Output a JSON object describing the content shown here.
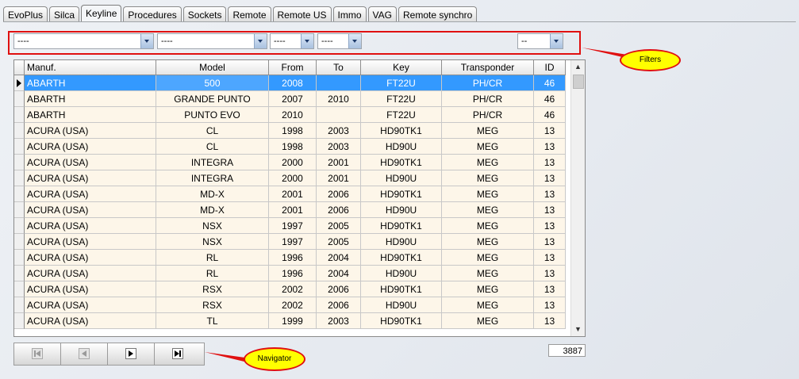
{
  "tabs": [
    "EvoPlus",
    "Silca",
    "Keyline",
    "Procedures",
    "Sockets",
    "Remote",
    "Remote US",
    "Immo",
    "VAG",
    "Remote synchro"
  ],
  "filters": {
    "manufacturer": "----",
    "model": "----",
    "from": "----",
    "to": "----",
    "id": "--"
  },
  "grid": {
    "columns": [
      "Manuf.",
      "Model",
      "From",
      "To",
      "Key",
      "Transponder",
      "ID"
    ],
    "rows": [
      [
        "ABARTH",
        "500",
        "2008",
        "",
        "FT22U",
        "PH/CR",
        "46"
      ],
      [
        "ABARTH",
        "GRANDE PUNTO",
        "2007",
        "2010",
        "FT22U",
        "PH/CR",
        "46"
      ],
      [
        "ABARTH",
        "PUNTO EVO",
        "2010",
        "",
        "FT22U",
        "PH/CR",
        "46"
      ],
      [
        "ACURA (USA)",
        "CL",
        "1998",
        "2003",
        "HD90TK1",
        "MEG",
        "13"
      ],
      [
        "ACURA (USA)",
        "CL",
        "1998",
        "2003",
        "HD90U",
        "MEG",
        "13"
      ],
      [
        "ACURA (USA)",
        "INTEGRA",
        "2000",
        "2001",
        "HD90TK1",
        "MEG",
        "13"
      ],
      [
        "ACURA (USA)",
        "INTEGRA",
        "2000",
        "2001",
        "HD90U",
        "MEG",
        "13"
      ],
      [
        "ACURA (USA)",
        "MD-X",
        "2001",
        "2006",
        "HD90TK1",
        "MEG",
        "13"
      ],
      [
        "ACURA (USA)",
        "MD-X",
        "2001",
        "2006",
        "HD90U",
        "MEG",
        "13"
      ],
      [
        "ACURA (USA)",
        "NSX",
        "1997",
        "2005",
        "HD90TK1",
        "MEG",
        "13"
      ],
      [
        "ACURA (USA)",
        "NSX",
        "1997",
        "2005",
        "HD90U",
        "MEG",
        "13"
      ],
      [
        "ACURA (USA)",
        "RL",
        "1996",
        "2004",
        "HD90TK1",
        "MEG",
        "13"
      ],
      [
        "ACURA (USA)",
        "RL",
        "1996",
        "2004",
        "HD90U",
        "MEG",
        "13"
      ],
      [
        "ACURA (USA)",
        "RSX",
        "2002",
        "2006",
        "HD90TK1",
        "MEG",
        "13"
      ],
      [
        "ACURA (USA)",
        "RSX",
        "2002",
        "2006",
        "HD90U",
        "MEG",
        "13"
      ],
      [
        "ACURA (USA)",
        "TL",
        "1999",
        "2003",
        "HD90TK1",
        "MEG",
        "13"
      ]
    ],
    "selected_row": 0
  },
  "record_count": "3887",
  "callouts": {
    "filters": "Filters",
    "navigator": "Navigator"
  },
  "colors": {
    "selection": "#3399ff",
    "row_background": "#fdf6e9",
    "callout_fill": "#ffff00",
    "callout_border": "#e01010"
  },
  "navigator": [
    "first-icon",
    "prev-icon",
    "next-icon",
    "last-icon"
  ]
}
